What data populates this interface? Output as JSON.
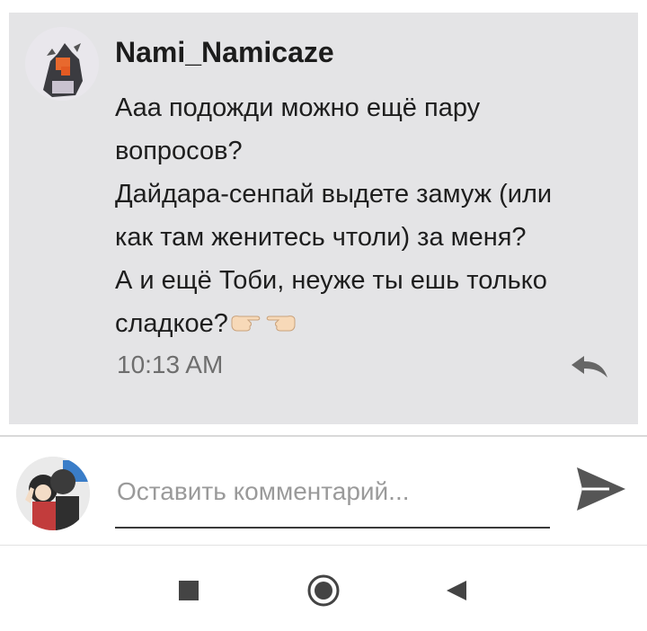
{
  "comment": {
    "author": "Nami_Namicaze",
    "lines": [
      "Ааа подожди можно ещё пару",
      "вопросов?",
      "Дайдара-сенпай выдете замуж (или",
      "как там женитесь чтоли) за меня?",
      "А и ещё Тоби, неуже ты ешь только",
      "сладкое?"
    ],
    "emoji": [
      "pointing-right-hand-icon",
      "pointing-left-hand-icon"
    ],
    "time": "10:13 AM",
    "reply_icon": "reply-arrow-icon"
  },
  "composer": {
    "placeholder": "Оставить комментарий...",
    "send_icon": "send-icon"
  },
  "navbar": {
    "icons": [
      "recents-square-icon",
      "home-circle-icon",
      "back-triangle-icon"
    ]
  },
  "colors": {
    "card_bg": "#e4e4e6",
    "text": "#1e1e1e",
    "muted": "#6e6e6e",
    "icon": "#555555"
  }
}
